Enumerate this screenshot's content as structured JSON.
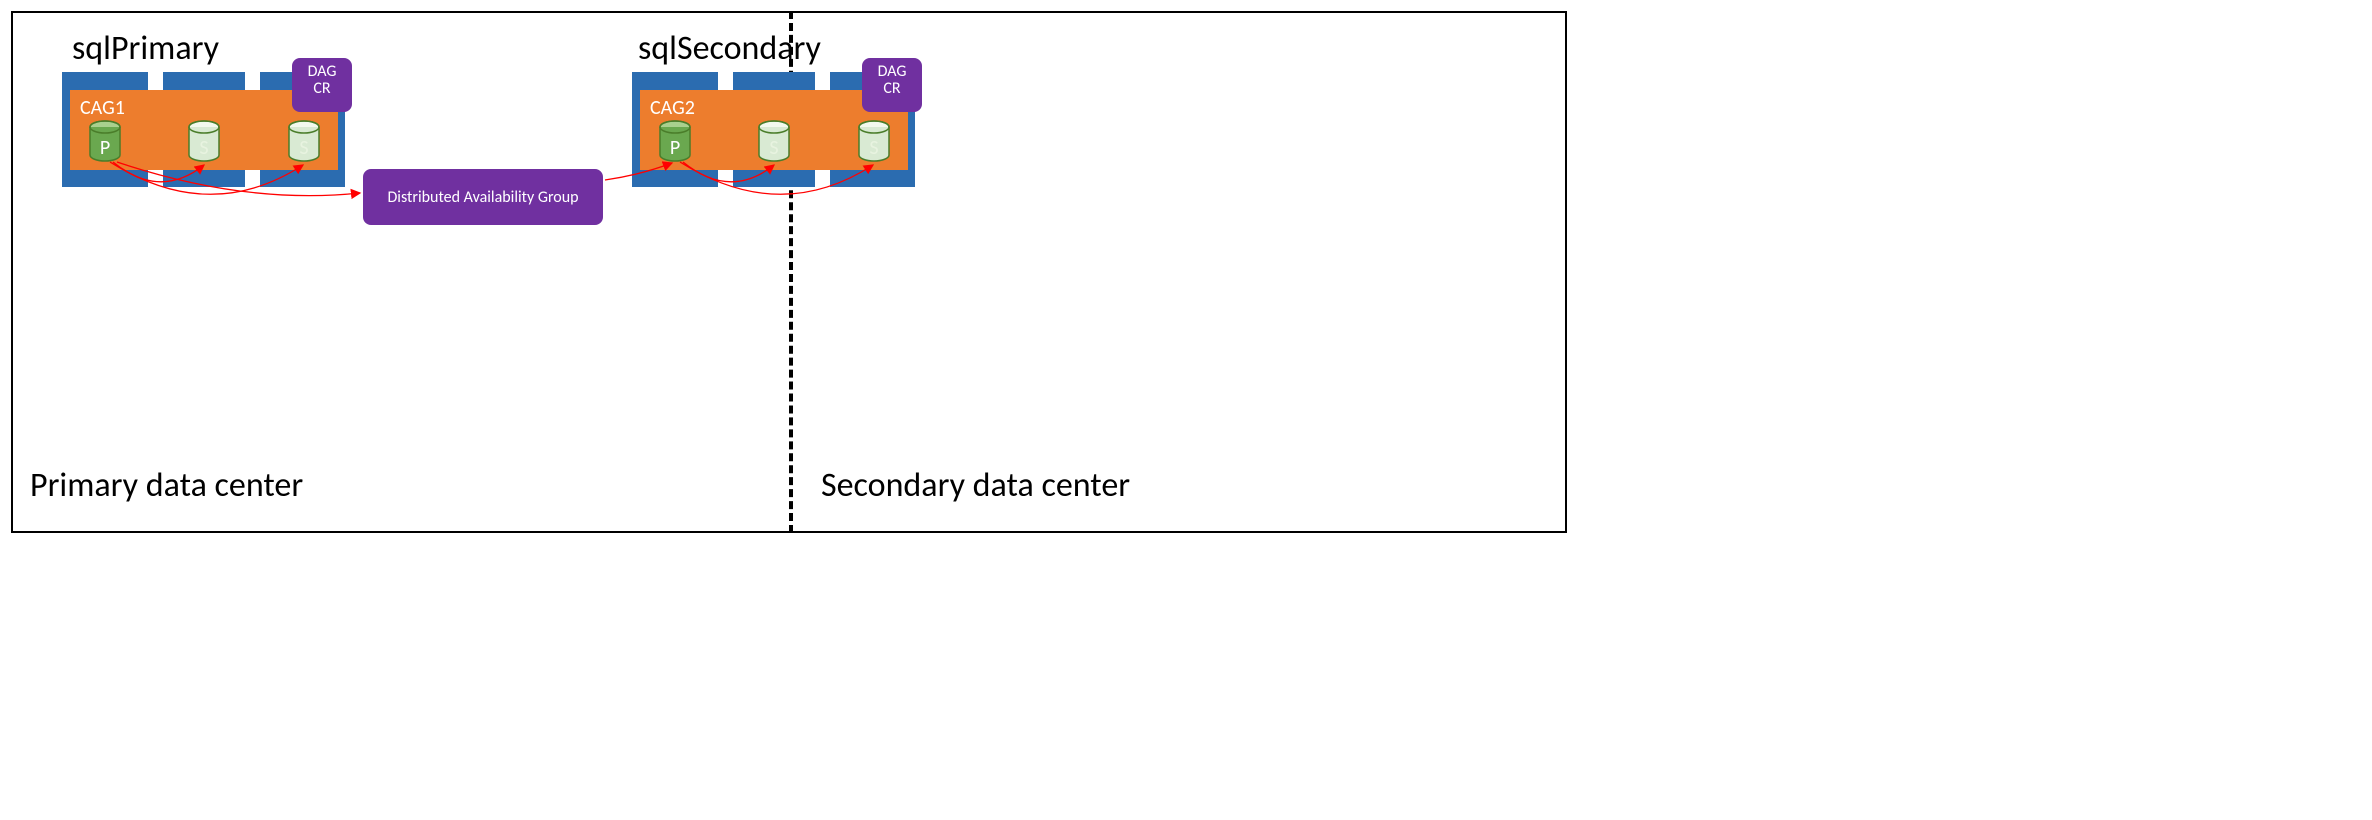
{
  "left": {
    "server_title": "sqlPrimary",
    "cag_label": "CAG1",
    "dag_badge_line1": "DAG",
    "dag_badge_line2": "CR",
    "dc_title": "Primary data center",
    "db1_label": "P",
    "db2_label": "S",
    "db3_label": "S"
  },
  "right": {
    "server_title": "sqlSecondary",
    "cag_label": "CAG2",
    "dag_badge_line1": "DAG",
    "dag_badge_line2": "CR",
    "dc_title": "Secondary data center",
    "db1_label": "P",
    "db2_label": "S",
    "db3_label": "S"
  },
  "center": {
    "dag_box_label": "Distributed Availability Group"
  },
  "colors": {
    "blue": "#2B6CB0",
    "orange": "#ED7D2D",
    "purple": "#7030A0",
    "db_primary_fill": "#6AA84F",
    "db_primary_top": "#A9D08E",
    "db_secondary_fill": "#D9EAD3",
    "db_secondary_top": "#F3F9EE",
    "db_stroke": "#4A7D2A",
    "arrow": "#FF0000"
  }
}
